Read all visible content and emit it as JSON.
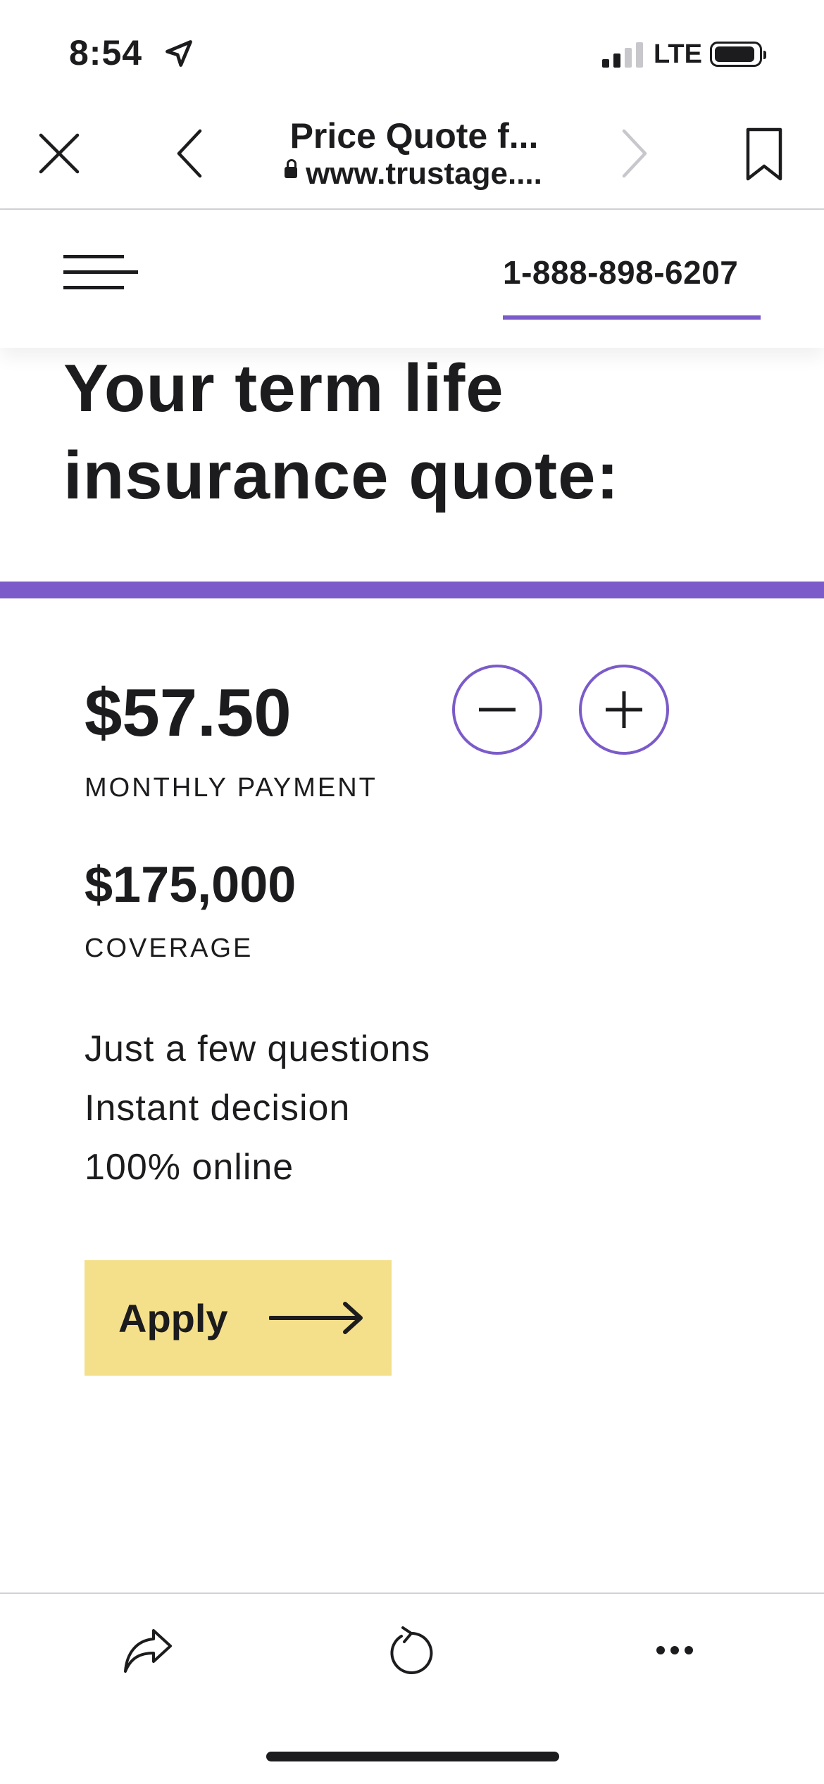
{
  "status_bar": {
    "time": "8:54",
    "network": "LTE",
    "icons": [
      "location-arrow-icon",
      "signal-icon",
      "battery-icon"
    ]
  },
  "browser": {
    "title": "Price Quote f...",
    "url": "www.trustage....",
    "icons": [
      "close-icon",
      "back-icon",
      "forward-icon",
      "bookmark-icon",
      "lock-icon"
    ]
  },
  "site_nav": {
    "phone": "1-888-898-6207",
    "accent_color": "#7b5bc9",
    "icons": [
      "hamburger-menu-icon"
    ]
  },
  "quote": {
    "headline_line1": "Your term life",
    "headline_line2": "insurance quote:",
    "monthly_payment": "$57.50",
    "monthly_payment_label": "MONTHLY PAYMENT",
    "coverage": "$175,000",
    "coverage_label": "COVERAGE",
    "features": [
      "Just a few questions",
      "Instant decision",
      "100% online"
    ],
    "apply_label": "Apply",
    "apply_color": "#f4e08b"
  },
  "toolbar": {
    "icons": [
      "share-icon",
      "reload-icon",
      "more-icon"
    ]
  }
}
